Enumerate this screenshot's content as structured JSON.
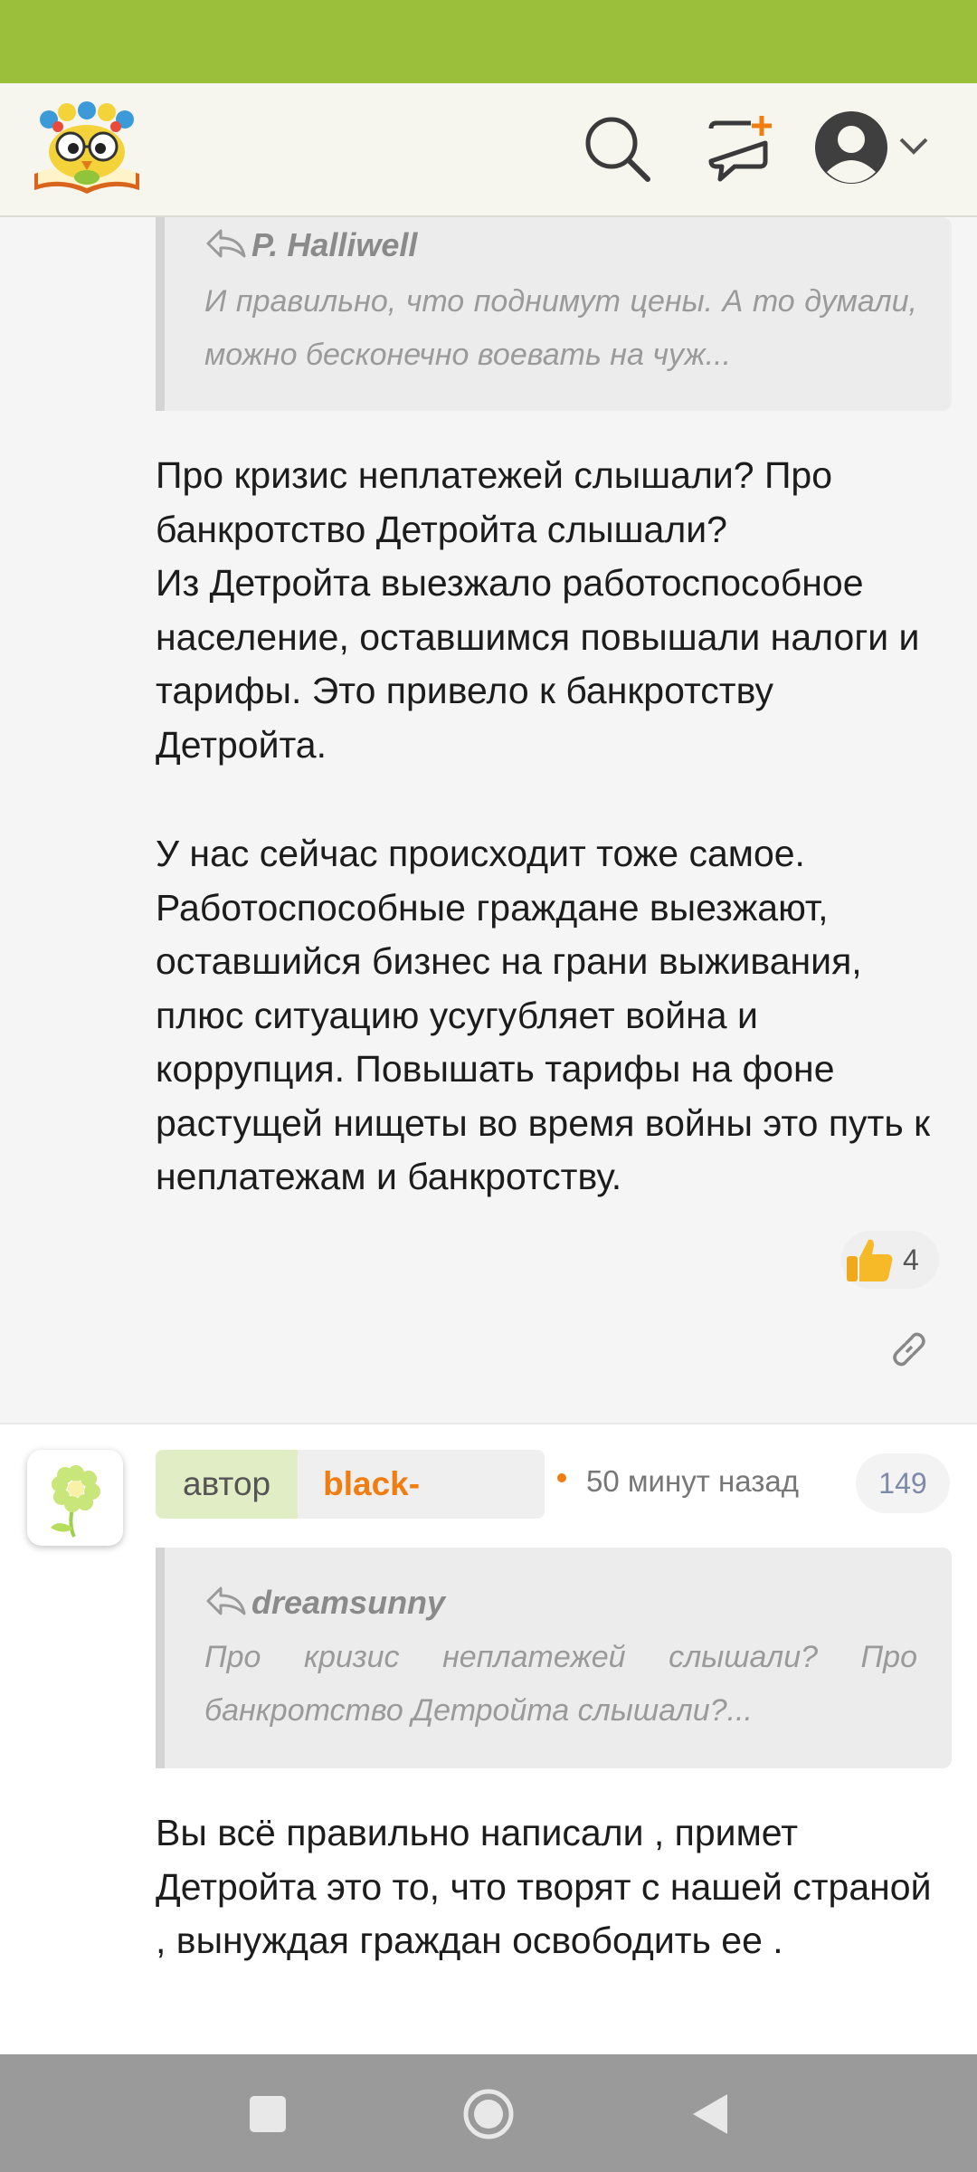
{
  "header": {
    "logo_icon": "owl-on-book-logo",
    "search_icon": "search-icon",
    "new_post_icon": "new-message-icon",
    "profile_icon": "user-avatar-icon"
  },
  "comments": [
    {
      "quote": {
        "author": "P. Halliwell",
        "text": "И правильно, что поднимут цены. А то думали, можно бесконечно воевать на чуж..."
      },
      "paragraphs": [
        "Про кризис неплатежей слышали? Про банкротство Детройта слышали?\nИз Детройта выезжало работоспособное население, оставшимся повышали налоги и тарифы. Это привело к банкротству Детройта.",
        "У нас сейчас происходит тоже самое. Работоспособные граждане выезжают, оставшийся бизнес на грани выживания, плюс ситуацию усугубляет война и коррупция. Повышать тарифы на фоне растущей нищеты во время войны это путь к неплатежам и банкротству."
      ],
      "likes": "4"
    },
    {
      "role": "автор",
      "username": "black-opium",
      "time": "50 минут назад",
      "number": "149",
      "quote": {
        "author": "dreamsunny",
        "text": "Про кризис неплатежей слышали? Про банкротство Детройта слышали?..."
      },
      "text": "Вы всё правильно написали , примет Детройта это то, что творят с нашей страной , вынуждая граждан освободить ее ."
    }
  ],
  "colors": {
    "status_bar": "#9bbf3b",
    "accent_orange": "#f07d10",
    "author_badge": "#e1edc5"
  }
}
